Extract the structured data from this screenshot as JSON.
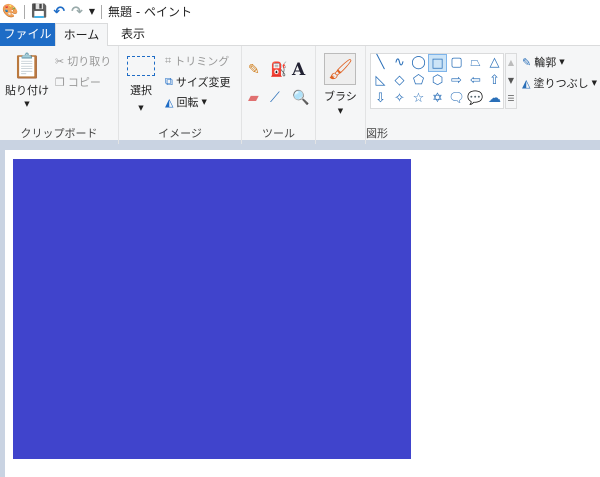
{
  "title": "無題 - ペイント",
  "tabs": {
    "file": "ファイル",
    "home": "ホーム",
    "view": "表示"
  },
  "clipboard": {
    "paste": "貼り付け",
    "cut": "切り取り",
    "copy": "コピー",
    "label": "クリップボード"
  },
  "image": {
    "select": "選択",
    "crop": "トリミング",
    "resize": "サイズ変更",
    "rotate": "回転",
    "label": "イメージ"
  },
  "tools": {
    "label": "ツール"
  },
  "brush": {
    "label": "ブラシ"
  },
  "shapes": {
    "outline": "輪郭",
    "fill": "塗りつぶし",
    "label": "図形",
    "glyphs": [
      "╲",
      "∿",
      "◯",
      "□",
      "▢",
      "⏢",
      "△",
      "◺",
      "◇",
      "⬠",
      "⬡",
      "⇨",
      "⇦",
      "⇧",
      "⇩",
      "✧",
      "☆",
      "✡",
      "🗨",
      "💬",
      "☁"
    ]
  },
  "colors": {
    "canvas_shape": "#4044cc",
    "file_tab": "#1e6cc6"
  }
}
